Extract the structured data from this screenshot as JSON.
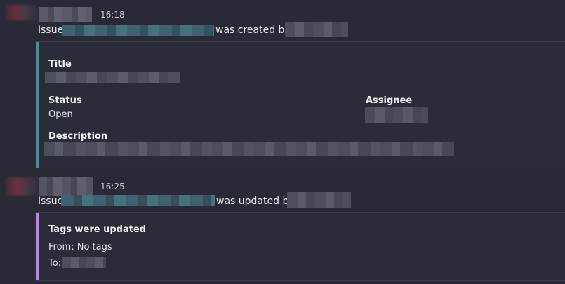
{
  "messages": [
    {
      "time": "16:18",
      "summary": {
        "prefix": "Issue",
        "action": "was created by"
      },
      "card": {
        "accent": "#4b8c9c",
        "title_label": "Title",
        "status_label": "Status",
        "status_value": "Open",
        "assignee_label": "Assignee",
        "description_label": "Description"
      }
    },
    {
      "time": "16:25",
      "summary": {
        "prefix": "Issue",
        "action": "was updated by"
      },
      "card": {
        "accent": "#b587e6",
        "heading": "Tags were updated",
        "from_text": "From: No tags",
        "to_label": "To:"
      }
    }
  ]
}
